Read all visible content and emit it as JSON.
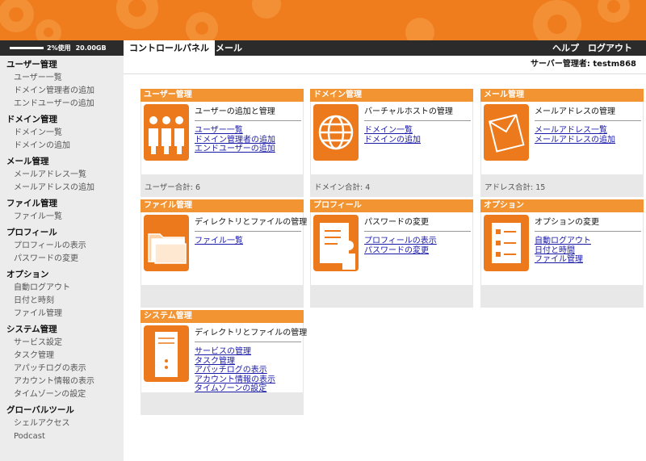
{
  "header": {
    "usage_text": "2%使用",
    "usage_percent": 2,
    "usage_total": "20.00GB",
    "tabs": [
      {
        "label": "コントロールパネル",
        "active": true
      },
      {
        "label": "メール",
        "active": false
      }
    ],
    "help_label": "ヘルプ",
    "logout_label": "ログアウト",
    "admin_info": "サーバー管理者: testm868",
    "colors": {
      "banner": "#ef7d1e",
      "bar": "#2b2b2b",
      "accent": "#f39433"
    }
  },
  "sidebar": {
    "sections": [
      {
        "title": "ユーザー管理",
        "items": [
          "ユーザー一覧",
          "ドメイン管理者の追加",
          "エンドユーザーの追加"
        ]
      },
      {
        "title": "ドメイン管理",
        "items": [
          "ドメイン一覧",
          "ドメインの追加"
        ]
      },
      {
        "title": "メール管理",
        "items": [
          "メールアドレス一覧",
          "メールアドレスの追加"
        ]
      },
      {
        "title": "ファイル管理",
        "items": [
          "ファイル一覧"
        ]
      },
      {
        "title": "プロフィール",
        "items": [
          "プロフィールの表示",
          "パスワードの変更"
        ]
      },
      {
        "title": "オプション",
        "items": [
          "自動ログアウト",
          "日付と時刻",
          "ファイル管理"
        ]
      },
      {
        "title": "システム管理",
        "items": [
          "サービス設定",
          "タスク管理",
          "アパッチログの表示",
          "アカウント情報の表示",
          "タイムゾーンの設定"
        ]
      },
      {
        "title": "グローバルツール",
        "items": [
          "シェルアクセス",
          "Podcast"
        ]
      }
    ]
  },
  "panels": [
    {
      "title": "ユーザー管理",
      "icon": "users-icon",
      "heading": "ユーザーの追加と管理",
      "links": [
        "ユーザー一覧",
        "ドメイン管理者の追加",
        "エンドユーザーの追加"
      ],
      "footer": "ユーザー合計: 6"
    },
    {
      "title": "ドメイン管理",
      "icon": "globe-icon",
      "heading": "バーチャルホストの管理",
      "links": [
        "ドメイン一覧",
        "ドメインの追加"
      ],
      "footer": "ドメイン合計: 4"
    },
    {
      "title": "メール管理",
      "icon": "mail-icon",
      "heading": "メールアドレスの管理",
      "links": [
        "メールアドレス一覧",
        "メールアドレスの追加"
      ],
      "footer": "アドレス合計: 15"
    },
    {
      "title": "ファイル管理",
      "icon": "folder-icon",
      "heading": "ディレクトリとファイルの管理",
      "links": [
        "ファイル一覧"
      ],
      "footer": ""
    },
    {
      "title": "プロフィール",
      "icon": "profile-icon",
      "heading": "パスワードの変更",
      "links": [
        "プロフィールの表示",
        "パスワードの変更"
      ],
      "footer": ""
    },
    {
      "title": "オプション",
      "icon": "checklist-icon",
      "heading": "オプションの変更",
      "links": [
        "自動ログアウト",
        "日付と時間",
        "ファイル管理"
      ],
      "footer": ""
    },
    {
      "title": "システム管理",
      "icon": "server-icon",
      "heading": "ディレクトリとファイルの管理",
      "links": [
        "サービスの管理",
        "タスク管理",
        "アパッチログの表示",
        "アカウント情報の表示",
        "タイムゾーンの設定"
      ],
      "footer": ""
    }
  ]
}
